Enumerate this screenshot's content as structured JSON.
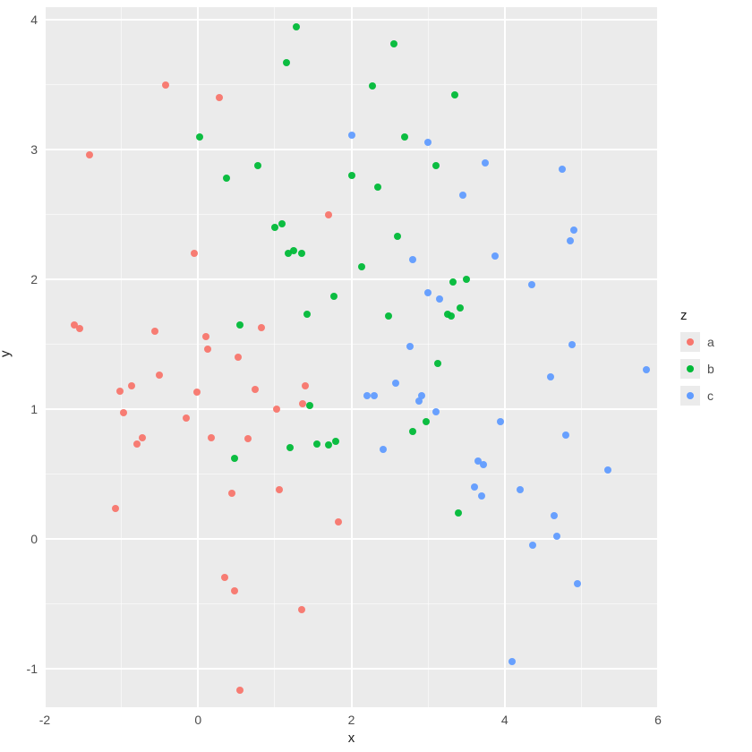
{
  "chart_data": {
    "type": "scatter",
    "xlabel": "x",
    "ylabel": "y",
    "legend_title": "z",
    "xlim": [
      -2,
      6
    ],
    "ylim": [
      -1.3,
      4.1
    ],
    "x_ticks": [
      -2,
      0,
      2,
      4,
      6
    ],
    "y_ticks": [
      -1,
      0,
      1,
      2,
      3,
      4
    ],
    "x_minor": [
      -1,
      1,
      3,
      5
    ],
    "y_minor": [
      -0.5,
      0.5,
      1.5,
      2.5,
      3.5
    ],
    "series": [
      {
        "name": "a",
        "color": "#F8766D",
        "points": [
          {
            "x": -1.62,
            "y": 1.65
          },
          {
            "x": -1.55,
            "y": 1.62
          },
          {
            "x": -1.42,
            "y": 2.96
          },
          {
            "x": -1.08,
            "y": 0.23
          },
          {
            "x": -1.02,
            "y": 1.14
          },
          {
            "x": -0.97,
            "y": 0.97
          },
          {
            "x": -0.87,
            "y": 1.18
          },
          {
            "x": -0.8,
            "y": 0.73
          },
          {
            "x": -0.73,
            "y": 0.78
          },
          {
            "x": -0.56,
            "y": 1.6
          },
          {
            "x": -0.5,
            "y": 1.26
          },
          {
            "x": -0.42,
            "y": 3.5
          },
          {
            "x": -0.16,
            "y": 0.93
          },
          {
            "x": -0.02,
            "y": 1.13
          },
          {
            "x": -0.05,
            "y": 2.2
          },
          {
            "x": 0.1,
            "y": 1.56
          },
          {
            "x": 0.17,
            "y": 0.78
          },
          {
            "x": 0.12,
            "y": 1.46
          },
          {
            "x": 0.28,
            "y": 3.4
          },
          {
            "x": 0.35,
            "y": -0.3
          },
          {
            "x": 0.44,
            "y": 0.35
          },
          {
            "x": 0.48,
            "y": -0.4
          },
          {
            "x": 0.52,
            "y": 1.4
          },
          {
            "x": 0.55,
            "y": -1.17
          },
          {
            "x": 0.65,
            "y": 0.77
          },
          {
            "x": 0.75,
            "y": 1.15
          },
          {
            "x": 0.83,
            "y": 1.63
          },
          {
            "x": 1.02,
            "y": 1.0
          },
          {
            "x": 1.06,
            "y": 0.38
          },
          {
            "x": 1.36,
            "y": 1.04
          },
          {
            "x": 1.4,
            "y": 1.18
          },
          {
            "x": 1.35,
            "y": -0.55
          },
          {
            "x": 1.7,
            "y": 2.5
          },
          {
            "x": 1.83,
            "y": 0.13
          }
        ]
      },
      {
        "name": "b",
        "color": "#00BA38",
        "points": [
          {
            "x": 0.02,
            "y": 3.1
          },
          {
            "x": 0.37,
            "y": 2.78
          },
          {
            "x": 0.48,
            "y": 0.62
          },
          {
            "x": 0.55,
            "y": 1.65
          },
          {
            "x": 0.78,
            "y": 2.88
          },
          {
            "x": 1.0,
            "y": 2.4
          },
          {
            "x": 1.1,
            "y": 2.43
          },
          {
            "x": 1.15,
            "y": 3.67
          },
          {
            "x": 1.18,
            "y": 2.2
          },
          {
            "x": 1.2,
            "y": 0.7
          },
          {
            "x": 1.25,
            "y": 2.22
          },
          {
            "x": 1.28,
            "y": 3.95
          },
          {
            "x": 1.35,
            "y": 2.2
          },
          {
            "x": 1.42,
            "y": 1.73
          },
          {
            "x": 1.46,
            "y": 1.03
          },
          {
            "x": 1.55,
            "y": 0.73
          },
          {
            "x": 1.7,
            "y": 0.72
          },
          {
            "x": 1.77,
            "y": 1.87
          },
          {
            "x": 1.8,
            "y": 0.75
          },
          {
            "x": 2.0,
            "y": 2.8
          },
          {
            "x": 2.13,
            "y": 2.1
          },
          {
            "x": 2.28,
            "y": 3.49
          },
          {
            "x": 2.35,
            "y": 2.71
          },
          {
            "x": 2.48,
            "y": 1.72
          },
          {
            "x": 2.55,
            "y": 3.82
          },
          {
            "x": 2.6,
            "y": 2.33
          },
          {
            "x": 2.7,
            "y": 3.1
          },
          {
            "x": 2.8,
            "y": 0.83
          },
          {
            "x": 2.97,
            "y": 0.9
          },
          {
            "x": 3.1,
            "y": 2.88
          },
          {
            "x": 3.13,
            "y": 1.35
          },
          {
            "x": 3.26,
            "y": 1.73
          },
          {
            "x": 3.3,
            "y": 1.72
          },
          {
            "x": 3.32,
            "y": 1.98
          },
          {
            "x": 3.35,
            "y": 3.42
          },
          {
            "x": 3.4,
            "y": 0.2
          },
          {
            "x": 3.42,
            "y": 1.78
          },
          {
            "x": 3.5,
            "y": 2.0
          }
        ]
      },
      {
        "name": "c",
        "color": "#619CFF",
        "points": [
          {
            "x": 2.0,
            "y": 3.11
          },
          {
            "x": 2.2,
            "y": 1.1
          },
          {
            "x": 2.3,
            "y": 1.1
          },
          {
            "x": 2.42,
            "y": 0.69
          },
          {
            "x": 2.58,
            "y": 1.2
          },
          {
            "x": 2.77,
            "y": 1.48
          },
          {
            "x": 2.8,
            "y": 2.15
          },
          {
            "x": 2.88,
            "y": 1.06
          },
          {
            "x": 2.92,
            "y": 1.1
          },
          {
            "x": 3.0,
            "y": 3.06
          },
          {
            "x": 3.0,
            "y": 1.9
          },
          {
            "x": 3.1,
            "y": 0.98
          },
          {
            "x": 3.15,
            "y": 1.85
          },
          {
            "x": 3.45,
            "y": 2.65
          },
          {
            "x": 3.6,
            "y": 0.4
          },
          {
            "x": 3.65,
            "y": 0.6
          },
          {
            "x": 3.7,
            "y": 0.33
          },
          {
            "x": 3.72,
            "y": 0.57
          },
          {
            "x": 3.75,
            "y": 2.9
          },
          {
            "x": 3.88,
            "y": 2.18
          },
          {
            "x": 3.95,
            "y": 0.9
          },
          {
            "x": 4.1,
            "y": -0.95
          },
          {
            "x": 4.2,
            "y": 0.38
          },
          {
            "x": 4.35,
            "y": 1.96
          },
          {
            "x": 4.37,
            "y": -0.05
          },
          {
            "x": 4.6,
            "y": 1.25
          },
          {
            "x": 4.65,
            "y": 0.18
          },
          {
            "x": 4.68,
            "y": 0.02
          },
          {
            "x": 4.75,
            "y": 2.85
          },
          {
            "x": 4.8,
            "y": 0.8
          },
          {
            "x": 4.85,
            "y": 2.3
          },
          {
            "x": 4.88,
            "y": 1.5
          },
          {
            "x": 4.9,
            "y": 2.38
          },
          {
            "x": 4.95,
            "y": -0.35
          },
          {
            "x": 5.35,
            "y": 0.53
          },
          {
            "x": 5.85,
            "y": 1.3
          }
        ]
      }
    ]
  }
}
